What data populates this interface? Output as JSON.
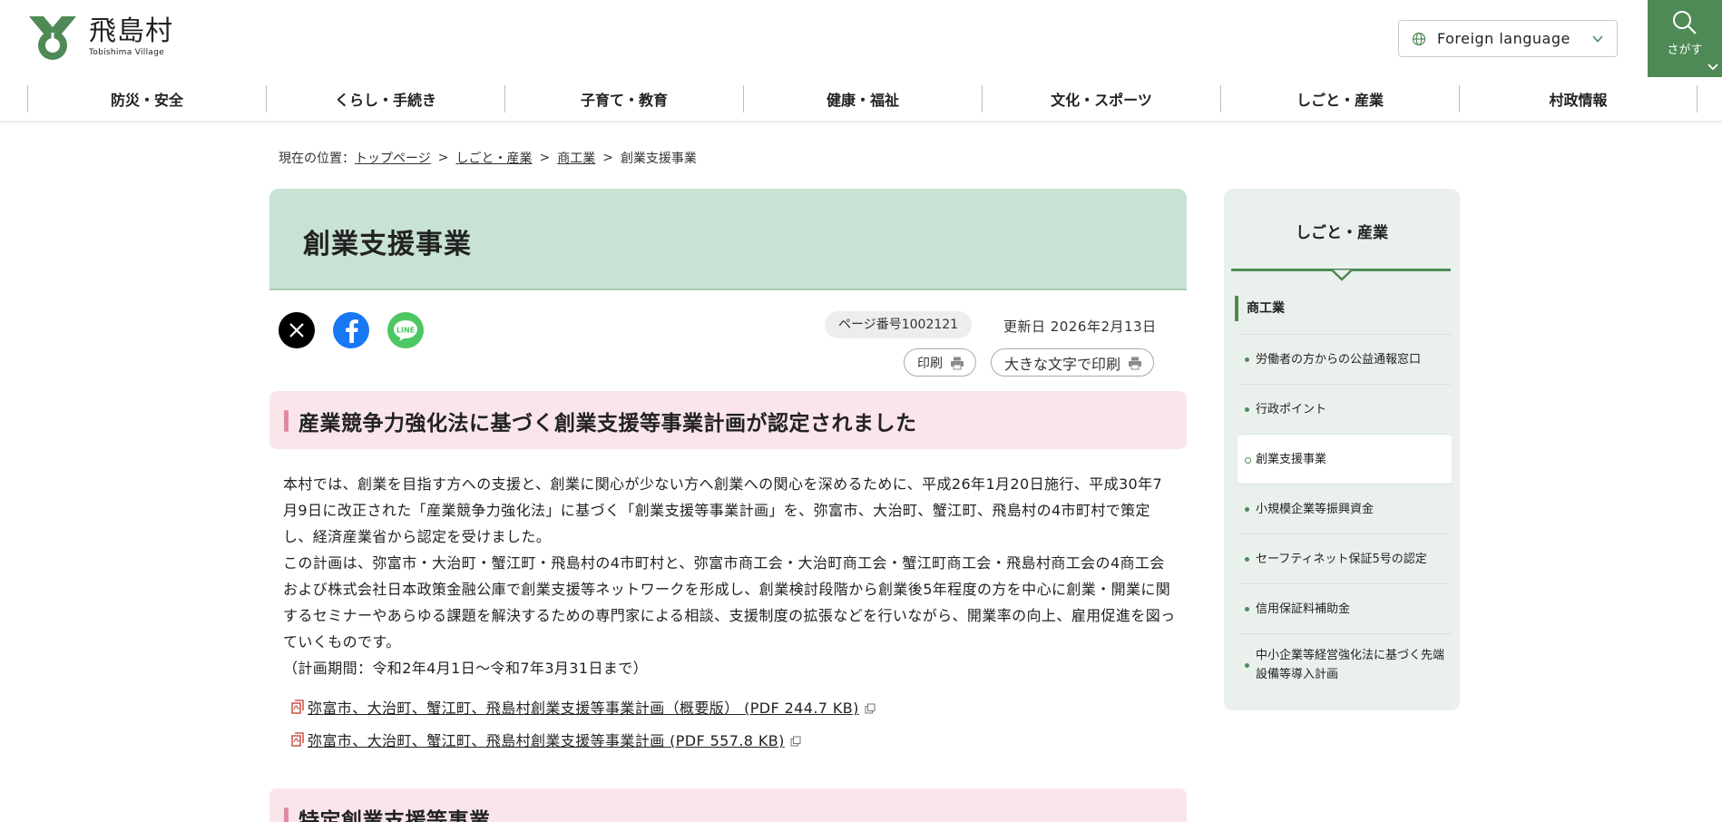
{
  "header": {
    "logo_name": "飛島村",
    "logo_sub": "Tobishima Village",
    "lang_label": "Foreign language",
    "search_label": "さがす",
    "brand_color": "#4f8a56"
  },
  "nav": {
    "items": [
      "防災・安全",
      "くらし・手続き",
      "子育て・教育",
      "健康・福祉",
      "文化・スポーツ",
      "しごと・産業",
      "村政情報"
    ]
  },
  "breadcrumb": {
    "prefix": "現在の位置：",
    "items": [
      "トップページ",
      "しごと・産業",
      "商工業",
      "創業支援事業"
    ],
    "separator": ">"
  },
  "page": {
    "title": "創業支援事業",
    "page_number": "ページ番号1002121",
    "updated": "更新日 2026年2月13日",
    "print_label": "印刷",
    "print_large_label": "大きな文字で印刷",
    "sns": [
      "x-icon",
      "facebook-icon",
      "line-icon"
    ],
    "line_icon_text": "LINE"
  },
  "section1": {
    "heading": "産業競争力強化法に基づく創業支援等事業計画が認定されました",
    "paragraphs": [
      "本村では、創業を目指す方への支援と、創業に関心が少ない方へ創業への関心を深めるために、平成26年1月20日施行、平成30年7月9日に改正された「産業競争力強化法」に基づく「創業支援等事業計画」を、弥富市、大治町、蟹江町、飛島村の4市町村で策定し、経済産業省から認定を受けました。",
      "この計画は、弥富市・大治町・蟹江町・飛島村の4市町村と、弥富市商工会・大治町商工会・蟹江町商工会・飛島村商工会の4商工会および株式会社日本政策金融公庫で創業支援等ネットワークを形成し、創業検討段階から創業後5年程度の方を中心に創業・開業に関するセミナーやあらゆる課題を解決するための専門家による相談、支援制度の拡張などを行いながら、開業率の向上、雇用促進を図っていくものです。",
      "（計画期間：令和2年4月1日～令和7年3月31日まで）"
    ],
    "links": [
      "弥富市、大治町、蟹江町、飛島村創業支援等事業計画（概要版） (PDF 244.7 KB)",
      "弥富市、大治町、蟹江町、飛島村創業支援等事業計画 (PDF 557.8 KB)"
    ]
  },
  "section2": {
    "heading": "特定創業支援等事業"
  },
  "sidebar": {
    "title": "しごと・産業",
    "category": "商工業",
    "items": [
      "労働者の方からの公益通報窓口",
      "行政ポイント",
      "創業支援事業",
      "小規模企業等振興資金",
      "セーフティネット保証5号の認定",
      "信用保証料補助金",
      "中小企業等経営強化法に基づく先端設備等導入計画"
    ],
    "active_index": 2
  }
}
